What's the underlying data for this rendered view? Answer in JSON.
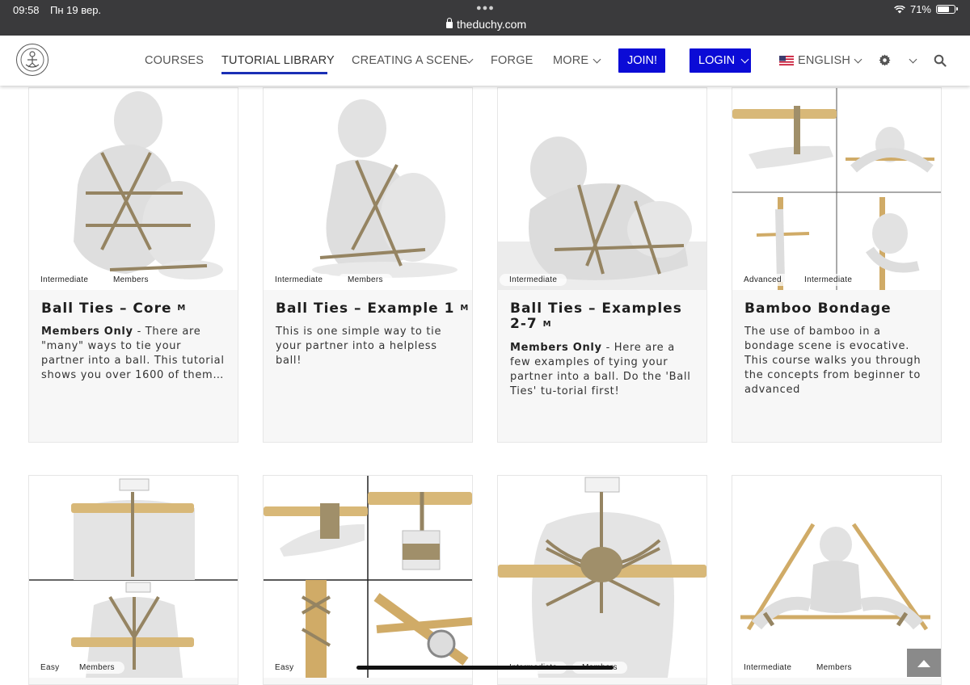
{
  "status_bar": {
    "time": "09:58",
    "date": "Пн 19 вер.",
    "url": "theduchy.com",
    "battery": "71%"
  },
  "nav": {
    "items": [
      {
        "label": "COURSES"
      },
      {
        "label": "TUTORIAL LIBRARY",
        "active": true
      },
      {
        "label": "CREATING A SCENE"
      },
      {
        "label": "FORGE"
      },
      {
        "label": "MORE"
      }
    ],
    "join_label": "JOIN!",
    "login_label": "LOGIN",
    "language_label": "ENGLISH",
    "accent_color": "#0b0bd6",
    "icons": [
      "logo-icon",
      "flag-us-icon",
      "gear-icon",
      "search-icon",
      "chevron-down-icon"
    ]
  },
  "cards": [
    {
      "tags": [
        "Intermediate",
        "Members"
      ],
      "title": "Ball Ties – Core",
      "mark": "M",
      "desc_bold": "Members Only",
      "desc": " - There are \"many\" ways to tie your partner into a ball. This tutorial shows you over 1600 of them…"
    },
    {
      "tags": [
        "Intermediate",
        "Members"
      ],
      "title": "Ball Ties – Example 1",
      "mark": "M",
      "desc_bold": "",
      "desc": "This is one simple way to tie your partner into a helpless ball!"
    },
    {
      "tags": [
        "Intermediate"
      ],
      "title": "Ball Ties – Examples 2-7",
      "mark": "M",
      "desc_bold": "Members Only",
      "desc": " - Here are a few examples of tying your partner into a ball. Do the 'Ball Ties' tu-torial first!"
    },
    {
      "tags": [
        "Advanced",
        "Intermediate"
      ],
      "title": "Bamboo Bondage",
      "mark": "",
      "desc_bold": "",
      "desc": "The use of bamboo in a bondage scene is evocative. This course walks you through the concepts from beginner to advanced"
    },
    {
      "tags": [
        "Easy",
        "Members"
      ]
    },
    {
      "tags": [
        "Easy"
      ]
    },
    {
      "tags": [
        "Intermediate",
        "Members"
      ]
    },
    {
      "tags": [
        "Intermediate",
        "Members"
      ]
    }
  ]
}
